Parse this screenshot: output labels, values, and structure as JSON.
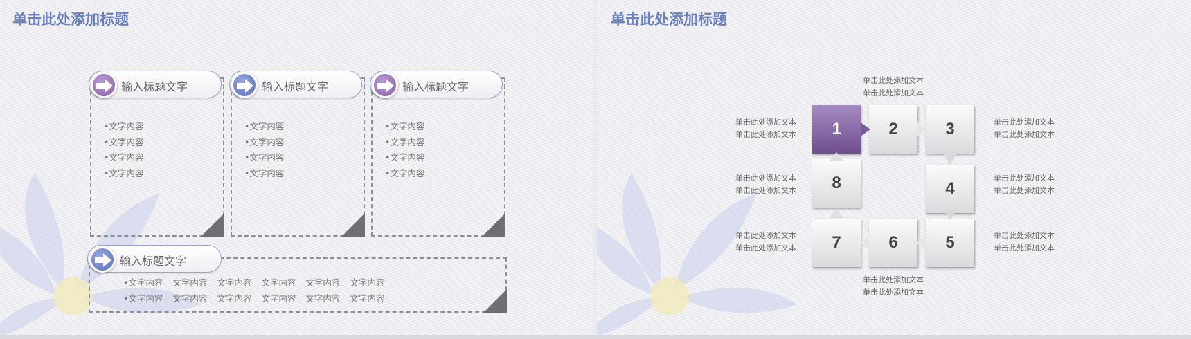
{
  "left_slide": {
    "title": "单击此处添加标题",
    "cards": [
      {
        "heading": "输入标题文字",
        "icon": "arrow-right-icon",
        "color": "purple",
        "bullets": [
          "•文字内容",
          "•文字内容",
          "•文字内容",
          "•文字内容"
        ]
      },
      {
        "heading": "输入标题文字",
        "icon": "arrow-right-icon",
        "color": "blue",
        "bullets": [
          "•文字内容",
          "•文字内容",
          "•文字内容",
          "•文字内容"
        ]
      },
      {
        "heading": "输入标题文字",
        "icon": "arrow-right-icon",
        "color": "purple",
        "bullets": [
          "•文字内容",
          "•文字内容",
          "•文字内容",
          "•文字内容"
        ]
      }
    ],
    "wide_card": {
      "heading": "输入标题文字",
      "icon": "arrow-right-icon",
      "color": "blue",
      "rows": [
        [
          "•文字内容",
          "文字内容",
          "文字内容",
          "文字内容",
          "文字内容",
          "文字内容"
        ],
        [
          "•文字内容",
          "文字内容",
          "文字内容",
          "文字内容",
          "文字内容",
          "文字内容"
        ]
      ]
    }
  },
  "right_slide": {
    "title": "单击此处添加标题",
    "tiles": [
      "1",
      "2",
      "3",
      "4",
      "5",
      "6",
      "7",
      "8"
    ],
    "active_tile": "1",
    "labels": {
      "top": [
        "单击此处添加文本",
        "单击此处添加文本"
      ],
      "left_1": [
        "单击此处添加文本",
        "单击此处添加文本"
      ],
      "left_8": [
        "单击此处添加文本",
        "单击此处添加文本"
      ],
      "left_7": [
        "单击此处添加文本",
        "单击此处添加文本"
      ],
      "right_3": [
        "单击此处添加文本",
        "单击此处添加文本"
      ],
      "right_4": [
        "单击此处添加文本",
        "单击此处添加文本"
      ],
      "right_5": [
        "单击此处添加文本",
        "单击此处添加文本"
      ],
      "bottom": [
        "单击此处添加文本",
        "单击此处添加文本"
      ]
    }
  },
  "colors": {
    "title": "#6a80c0",
    "purple": "#8a5fa8",
    "blue": "#5a6fb8",
    "active_tile": "#7a5a9c"
  }
}
